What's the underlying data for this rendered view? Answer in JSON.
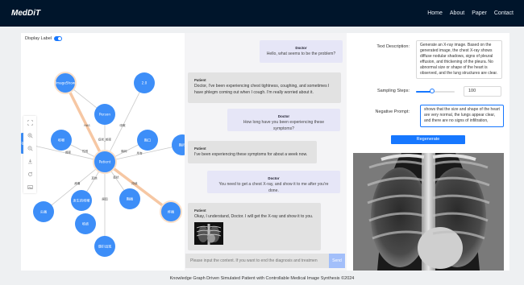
{
  "app": {
    "brand": "MedDiT"
  },
  "nav": [
    "Home",
    "About",
    "Paper",
    "Contact"
  ],
  "graph": {
    "toggle_label": "Display Label",
    "toggle_on": true,
    "nodes": [
      "ImageShow",
      "2.0",
      "Person",
      "咳嗽",
      "胸口",
      "Patient",
      "不能喝",
      "胸闷",
      "头痛",
      "发生的咳嗽",
      "胸痛",
      "疼痛",
      "偶尔出现",
      "咳痰"
    ],
    "edge_labels": [
      "HAS",
      "咳嗽",
      "症状_频率",
      "性别",
      "胸闷",
      "频率",
      "所有",
      "疼痛",
      "其他",
      "症状",
      "持续",
      "原因"
    ],
    "tools": [
      "fit-icon",
      "zoom-in-icon",
      "zoom-out-icon",
      "download-icon",
      "refresh-icon",
      "image-icon"
    ]
  },
  "chat": {
    "messages": [
      {
        "role": "doctor",
        "who": "Doctor",
        "text": "Hello, what seems to be the problem?"
      },
      {
        "role": "patient",
        "who": "Patient",
        "text": "Doctor, I've been experiencing chest tightness, coughing, and sometimes I have phlegm coming out when I cough. I'm really worried about it."
      },
      {
        "role": "doctor",
        "who": "Doctor",
        "text": "How long have you been experiencing these symptoms?"
      },
      {
        "role": "patient",
        "who": "Patient",
        "text": "I've been experiencing these symptoms for about a week now."
      },
      {
        "role": "doctor",
        "who": "Doctor",
        "text": "You need to get a chest X-ray, and show it to me after you're done."
      },
      {
        "role": "patient",
        "who": "Patient",
        "text": "Okay, I understand, Doctor. I will get the X-ray and show it to you."
      }
    ],
    "input_placeholder": "Please input the content. If you want to end the diagnosis and treatmen",
    "send_label": "Send"
  },
  "form": {
    "text_description_label": "Text Description:",
    "text_description": "Generate an X-ray image. Based on the generated image, the chest X-ray shows diffuse nodular shadows, signs of pleural effusion, and thickening of the pleura. No abnormal size or shape of the heart is observed, and the lung structures are clear.",
    "sampling_steps_label": "Sampling Steps:",
    "sampling_steps": "100",
    "slider_fraction": 0.42,
    "negative_prompt_label": "Negative Prompt:",
    "negative_prompt": "shows that the size and shape of the heart are very normal, the lungs appear clear, and there are no signs of infiltration,",
    "regenerate_label": "Regenerate"
  },
  "footer": {
    "text": "Knowledge Graph Driven Simulated Patient with Controllable Medical Image Synthesis ©2024"
  },
  "colors": {
    "nav_bg": "#00152b",
    "accent": "#1677ff",
    "node": "#3d8ef8",
    "edge_highlight": "#f6c7a3"
  }
}
